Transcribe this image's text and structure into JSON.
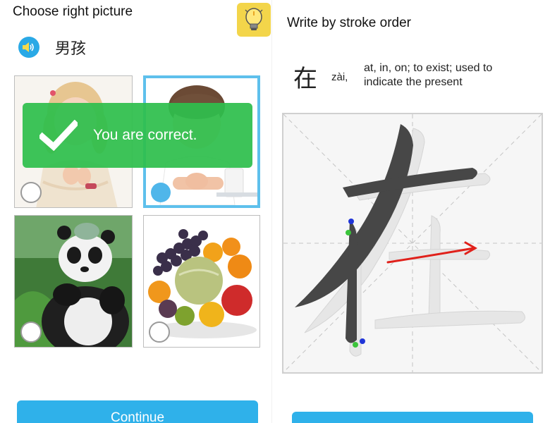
{
  "quiz": {
    "title": "Choose right picture",
    "audio_word": "男孩",
    "feedback": "You are correct.",
    "continue_label": "Continue",
    "options": [
      {
        "name": "girl",
        "selected": false
      },
      {
        "name": "boy",
        "selected": true
      },
      {
        "name": "panda",
        "selected": false
      },
      {
        "name": "fruit",
        "selected": false
      }
    ]
  },
  "stroke": {
    "title": "Write by stroke order",
    "character": "在",
    "pinyin": "zài,",
    "meaning": "at, in, on; to exist; used to indicate the present"
  },
  "colors": {
    "accent": "#2fb1ea",
    "success": "#2ebe4c",
    "hint": "#f3d54a",
    "arrow": "#e0201a"
  },
  "icons": [
    "speaker-icon",
    "lightbulb-icon",
    "check-icon"
  ]
}
